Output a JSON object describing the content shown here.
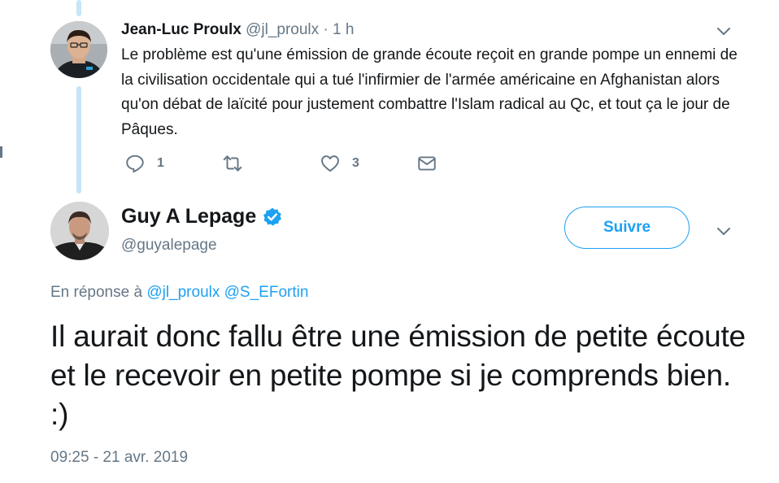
{
  "reply_tweet": {
    "author_name": "Jean-Luc Proulx",
    "author_handle": "@jl_proulx",
    "separator": "·",
    "time": "1 h",
    "text": "Le problème est qu'une émission de grande écoute reçoit en grande pompe un ennemi de la civilisation occidentale qui a tué l'infirmier de l'armée américaine en Afghanistan alors qu'on débat de laïcité pour justement combattre l'Islam radical au Qc, et tout ça le jour de Pâques.",
    "actions": {
      "reply_count": "1",
      "retweet_count": "",
      "like_count": "3"
    }
  },
  "main_tweet": {
    "author_name": "Guy A Lepage",
    "author_handle": "@guyalepage",
    "follow_label": "Suivre",
    "in_reply_prefix": "En réponse à",
    "in_reply_handles": [
      "@jl_proulx",
      "@S_EFortin"
    ],
    "text": "Il aurait donc fallu être une émission de petite écoute et le recevoir en petite pompe si je comprends bien. :)",
    "timestamp": "09:25 - 21 avr. 2019"
  },
  "icons": {
    "reply": "reply-icon",
    "retweet": "retweet-icon",
    "like": "heart-icon",
    "dm": "envelope-icon",
    "verified": "verified-badge-icon",
    "more": "chevron-down-icon"
  },
  "colors": {
    "accent": "#1da1f2",
    "secondary_text": "#657786",
    "primary_text": "#14171a",
    "thread_line": "#c4e6f8"
  }
}
